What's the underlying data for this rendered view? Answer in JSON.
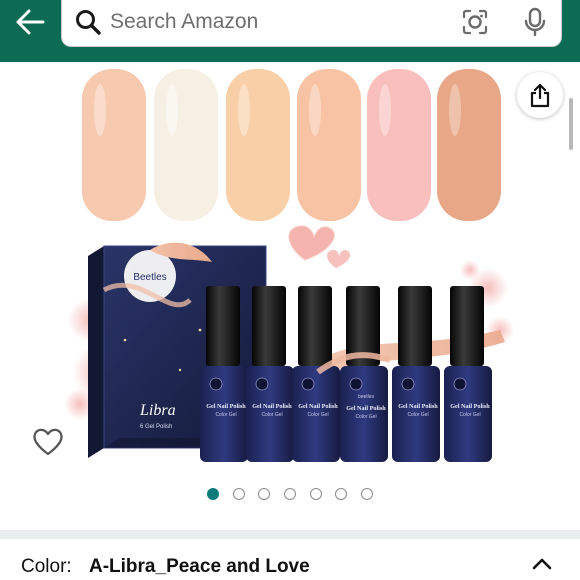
{
  "header": {
    "background_color": "#0c6b52",
    "search_placeholder": "Search Amazon",
    "icons": [
      "back-arrow-icon",
      "search-icon",
      "camera-lens-icon",
      "microphone-icon"
    ]
  },
  "product_image": {
    "brand_label": "Beetles",
    "box_title": "Libra",
    "box_subtitle": "6 Gel Polish",
    "bottle_label": "Gel Nail Polish",
    "bottle_sublabel": "Color Gel",
    "bottle_brand": "beetles",
    "swatch_colors": [
      "#f7c9ae",
      "#f6efe3",
      "#f8cfa6",
      "#f8c2a4",
      "#f8bfbd",
      "#e8a887"
    ]
  },
  "gallery": {
    "dot_count": 7,
    "active_dot_index": 0,
    "accent_color": "#0c7b7a",
    "icons": [
      "share-icon",
      "heart-icon"
    ]
  },
  "variation": {
    "label": "Color:",
    "value": "A-Libra_Peace and Love",
    "icon": "chevron-up-icon"
  }
}
